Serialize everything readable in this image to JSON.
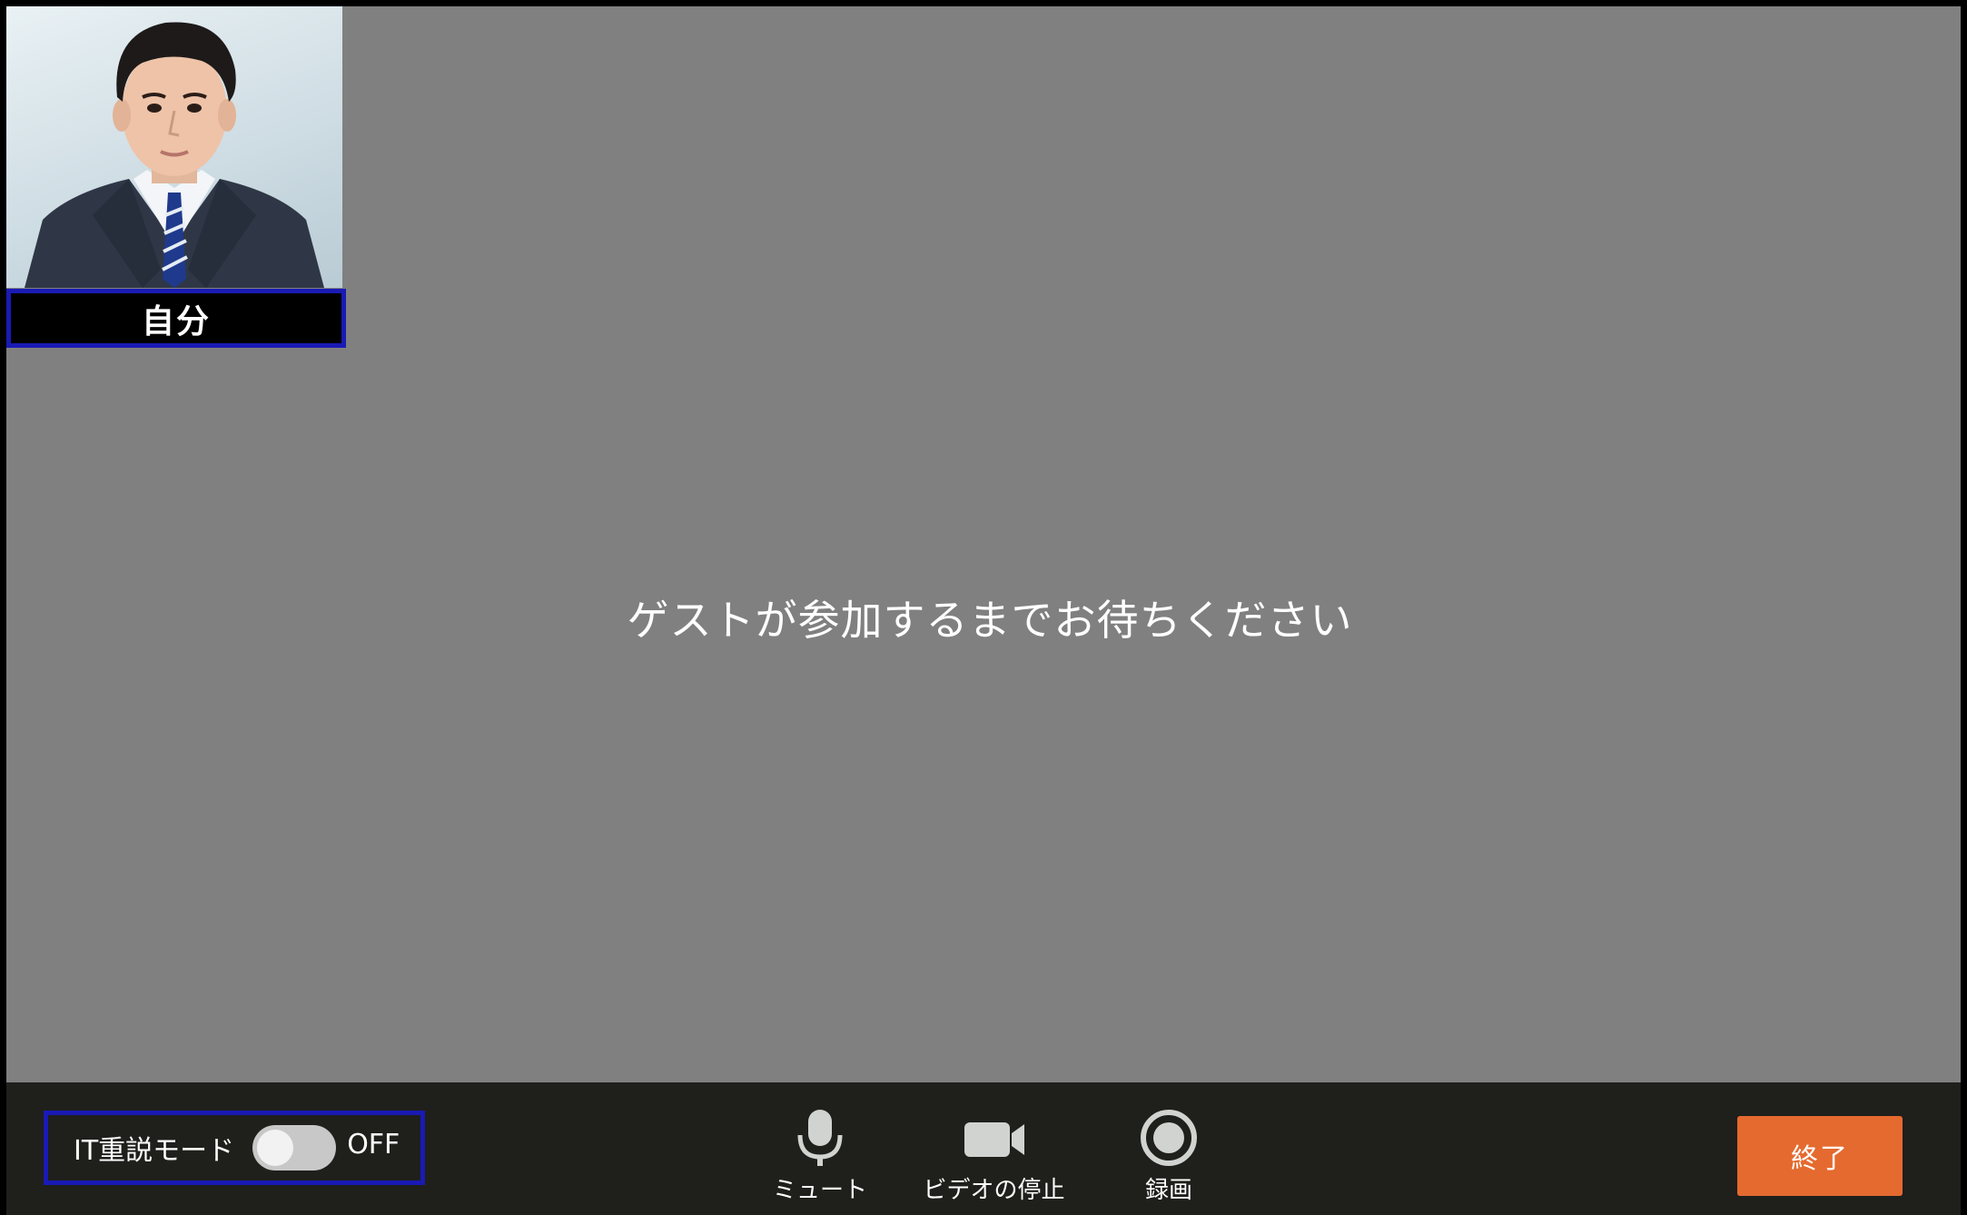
{
  "self_view": {
    "label": "自分",
    "photo_description_icon": "self-camera-image"
  },
  "stage": {
    "waiting_message": "ゲストが参加するまでお待ちください"
  },
  "toolbar": {
    "it_mode": {
      "label": "IT重説モード",
      "state": "OFF",
      "enabled": false
    },
    "controls": {
      "mute_label": "ミュート",
      "video_label": "ビデオの停止",
      "record_label": "録画"
    },
    "end_label": "終了"
  },
  "colors": {
    "stage_bg": "#808080",
    "toolbar_bg": "#1f1f1c",
    "highlight_border": "#1a1ab4",
    "end_button": "#e56a2f",
    "icon_gray": "#d0d3d0"
  }
}
